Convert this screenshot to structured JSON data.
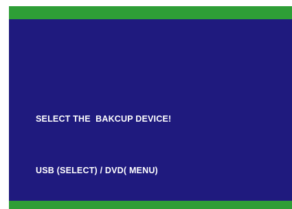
{
  "colors": {
    "frame_bar": "#2e9e36",
    "panel_background": "#1f1a7e",
    "text": "#ffffff"
  },
  "dialog": {
    "line1": "SELECT THE  BAKCUP DEVICE!",
    "line2": "USB (SELECT) / DVD( MENU)"
  }
}
